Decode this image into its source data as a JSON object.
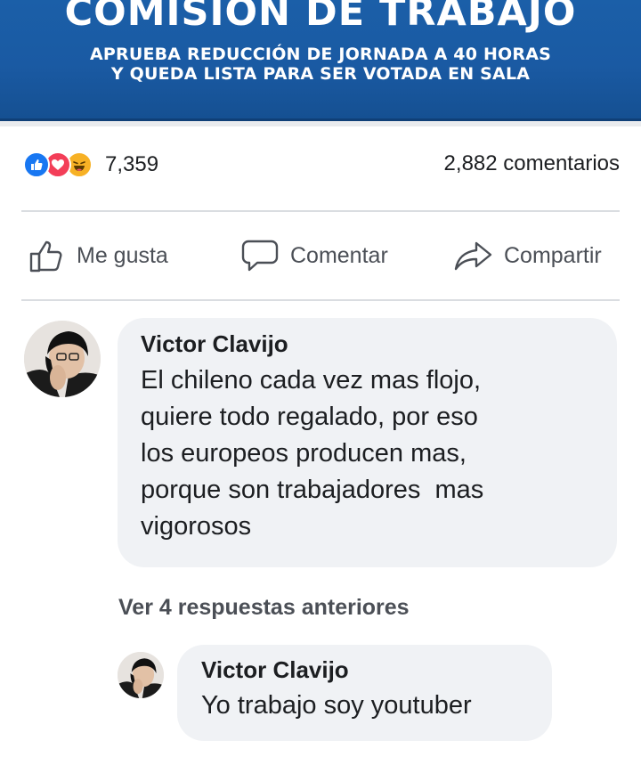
{
  "banner": {
    "title": "COMISIÓN DE TRABAJO",
    "subtitle_line1": "APRUEBA REDUCCIÓN DE JORNADA A 40 HORAS",
    "subtitle_line2": "Y QUEDA LISTA PARA SER VOTADA EN SALA",
    "background_color": "#1a5aa3"
  },
  "post_stats": {
    "reaction_icons": [
      "like-icon",
      "love-icon",
      "haha-icon"
    ],
    "reaction_count": "7,359",
    "comments_count": "2,882 comentarios"
  },
  "actions": {
    "like_label": "Me gusta",
    "comment_label": "Comentar",
    "share_label": "Compartir"
  },
  "comment": {
    "author": "Victor Clavijo",
    "text_lines": [
      "El chileno cada vez mas flojo,",
      "quiere todo regalado, por eso",
      "los europeos producen mas,",
      "porque son trabajadores  mas",
      "vigorosos"
    ]
  },
  "view_replies_label": "Ver 4 respuestas anteriores",
  "reply": {
    "author": "Victor Clavijo",
    "text": "Yo trabajo soy youtuber"
  },
  "colors": {
    "facebook_blue": "#1877f2",
    "bubble_bg": "#f0f2f5",
    "secondary_text": "#4b4f56"
  }
}
